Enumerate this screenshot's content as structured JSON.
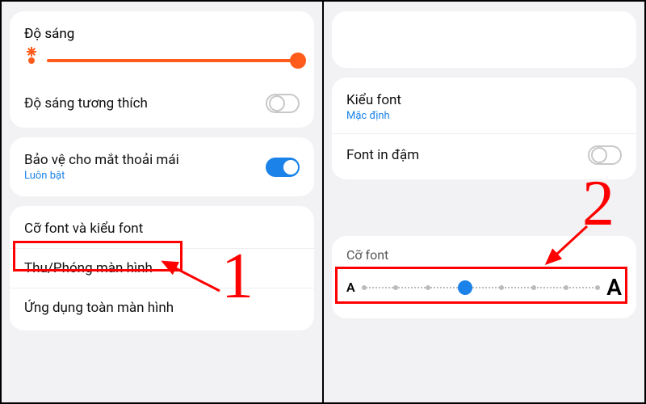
{
  "left": {
    "brightness": {
      "title": "Độ sáng"
    },
    "adaptive": {
      "label": "Độ sáng tương thích",
      "state": "off"
    },
    "eye": {
      "label": "Bảo vệ cho mắt thoải mái",
      "sub": "Luôn bật",
      "state": "on"
    },
    "fontsize_style": {
      "label": "Cỡ font và kiểu font"
    },
    "zoom": {
      "label": "Thu/Phóng màn hình"
    },
    "fullscreen": {
      "label": "Ứng dụng toàn màn hình"
    }
  },
  "right": {
    "fontstyle": {
      "label": "Kiểu font",
      "sub": "Mặc định"
    },
    "bold": {
      "label": "Font in đậm",
      "state": "off"
    },
    "fontsize": {
      "title": "Cỡ font",
      "small": "A",
      "big": "A",
      "steps": 8,
      "active": 3
    }
  },
  "annot": {
    "one": "1",
    "two": "2"
  }
}
